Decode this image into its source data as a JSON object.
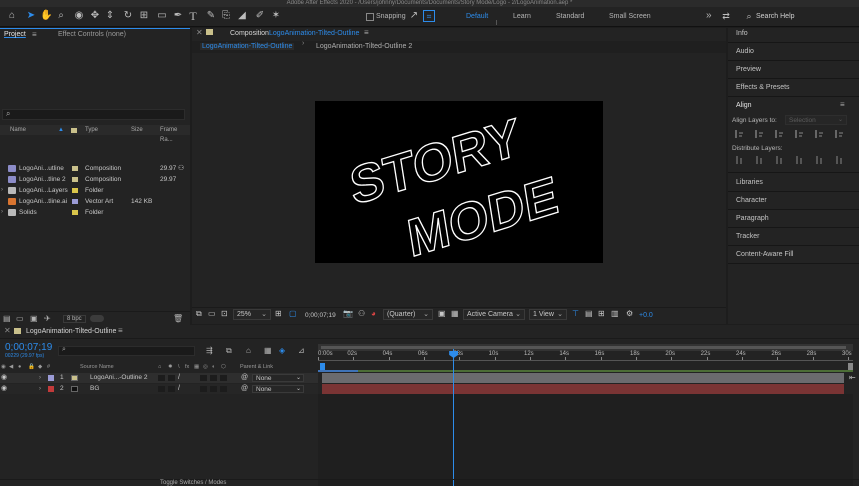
{
  "window_title": "Adobe After Effects 2020 - /Users/johnny/Documents/Documents/Story Mode/Logo - 2/LogoAnimation.aep *",
  "toolbar": {
    "snapping_label": "Snapping",
    "workspaces": [
      "Default",
      "Learn",
      "Standard",
      "Small Screen"
    ],
    "more_label": "»",
    "search_placeholder": "Search Help"
  },
  "left_panel": {
    "tabs": [
      "Project",
      "Effect Controls (none)"
    ],
    "columns": [
      "Name",
      "Type",
      "Size",
      "Frame Ra..."
    ],
    "items": [
      {
        "name": "LogoAni...utline",
        "type": "Composition",
        "size": "",
        "fps": "29.97",
        "icon_color": "#8c8cc8",
        "swatch": "#c9c08b"
      },
      {
        "name": "LogoAni...tline 2",
        "type": "Composition",
        "size": "",
        "fps": "29.97",
        "icon_color": "#8c8cc8",
        "swatch": "#c9c08b"
      },
      {
        "name": "LogoAni...Layers",
        "type": "Folder",
        "size": "",
        "fps": "",
        "icon_color": "#b9b9b9",
        "swatch": "#d9c54b"
      },
      {
        "name": "LogoAni...tline.ai",
        "type": "Vector Art",
        "size": "142 KB",
        "fps": "",
        "icon_color": "#d87430",
        "swatch": "#9b9bd6"
      },
      {
        "name": "Solids",
        "type": "Folder",
        "size": "",
        "fps": "",
        "icon_color": "#b9b9b9",
        "swatch": "#d9c54b"
      }
    ],
    "bpc_label": "8 bpc"
  },
  "composition": {
    "panel_title": "Composition",
    "comp_name": "LogoAnimation-Tilted-Outline",
    "tabs": [
      "LogoAnimation-Tilted-Outline",
      "LogoAnimation-Tilted-Outline 2"
    ],
    "logo_line1": "STORY",
    "logo_line2": "MODE",
    "controls": {
      "zoom": "25%",
      "timecode": "0;00;07;19",
      "resolution": "(Quarter)",
      "camera": "Active Camera",
      "views": "1 View",
      "exposure": "+0.0"
    }
  },
  "right_panel": {
    "items": [
      "Info",
      "Audio",
      "Preview",
      "Effects & Presets"
    ],
    "align_title": "Align",
    "align_layers_to_label": "Align Layers to:",
    "align_layers_to_value": "Selection",
    "distribute_label": "Distribute Layers:",
    "bottom_items": [
      "Libraries",
      "Character",
      "Paragraph",
      "Tracker",
      "Content-Aware Fill"
    ]
  },
  "timeline": {
    "comp_tab": "LogoAnimation-Tilted-Outline",
    "timecode": "0;00;07;19",
    "frame_info": "00229 (29.97 fps)",
    "columns": {
      "num": "#",
      "source": "Source Name",
      "parent": "Parent & Link"
    },
    "layers": [
      {
        "num": "1",
        "name": "LogoAni...-Outline 2",
        "parent": "None",
        "label_color": "#9b9bd6"
      },
      {
        "num": "2",
        "name": "BG",
        "parent": "None",
        "label_color": "#c23a3a"
      }
    ],
    "ticks": [
      "0:00s",
      "02s",
      "04s",
      "06s",
      "08s",
      "10s",
      "12s",
      "14s",
      "16s",
      "18s",
      "20s",
      "22s",
      "24s",
      "26s",
      "28s",
      "30s"
    ],
    "playhead_fraction": 0.255,
    "footer_label": "Toggle Switches / Modes"
  },
  "colors": {
    "accent": "#2d8ceb",
    "layer1_bar": "#6b6b6e",
    "layer2_bar": "#7a3434"
  }
}
